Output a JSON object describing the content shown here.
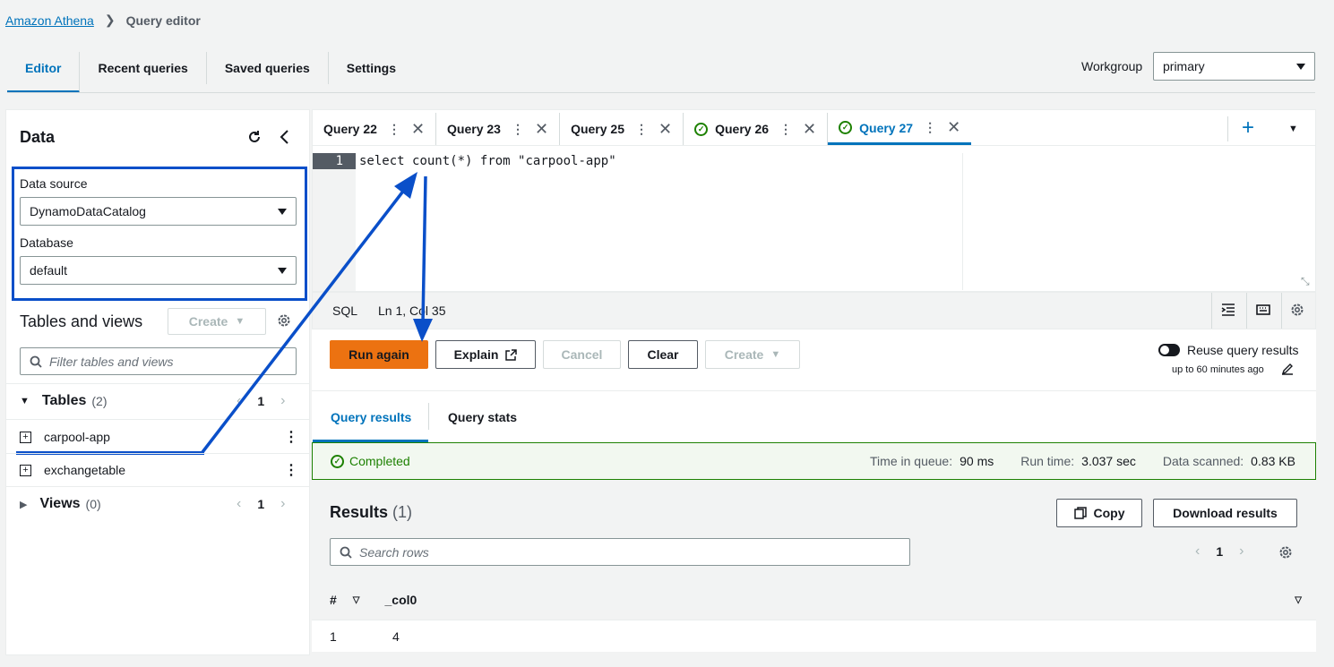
{
  "breadcrumb": {
    "root": "Amazon Athena",
    "current": "Query editor"
  },
  "top_tabs": [
    {
      "label": "Editor",
      "active": true
    },
    {
      "label": "Recent queries",
      "active": false
    },
    {
      "label": "Saved queries",
      "active": false
    },
    {
      "label": "Settings",
      "active": false
    }
  ],
  "workgroup": {
    "label": "Workgroup",
    "value": "primary"
  },
  "data_panel": {
    "title": "Data",
    "data_source_label": "Data source",
    "data_source_value": "DynamoDataCatalog",
    "database_label": "Database",
    "database_value": "default",
    "tables_and_views_title": "Tables and views",
    "create_label": "Create",
    "filter_placeholder": "Filter tables and views",
    "tables_label": "Tables",
    "tables_count": "(2)",
    "tables_page": "1",
    "tables": [
      {
        "name": "carpool-app"
      },
      {
        "name": "exchangetable"
      }
    ],
    "views_label": "Views",
    "views_count": "(0)",
    "views_page": "1"
  },
  "query_tabs": [
    {
      "label": "Query 22",
      "completed": false,
      "active": false
    },
    {
      "label": "Query 23",
      "completed": false,
      "active": false
    },
    {
      "label": "Query 25",
      "completed": false,
      "active": false
    },
    {
      "label": "Query 26",
      "completed": true,
      "active": false
    },
    {
      "label": "Query 27",
      "completed": true,
      "active": true
    }
  ],
  "editor": {
    "line_number": "1",
    "code_keyword": "select",
    "code_func": "count(*)",
    "code_from": "from",
    "code_string": "\"carpool-app\"",
    "language": "SQL",
    "cursor_pos": "Ln 1, Col 35"
  },
  "actions": {
    "run_again": "Run again",
    "explain": "Explain",
    "cancel": "Cancel",
    "clear": "Clear",
    "create": "Create",
    "reuse_label": "Reuse query results",
    "reuse_sub": "up to 60 minutes ago"
  },
  "results_tabs": {
    "results": "Query results",
    "stats": "Query stats"
  },
  "status": {
    "state": "Completed",
    "time_in_queue_label": "Time in queue:",
    "time_in_queue": "90 ms",
    "run_time_label": "Run time:",
    "run_time": "3.037 sec",
    "data_scanned_label": "Data scanned:",
    "data_scanned": "0.83 KB"
  },
  "results": {
    "title": "Results",
    "count": "(1)",
    "copy_label": "Copy",
    "download_label": "Download results",
    "search_placeholder": "Search rows",
    "page": "1",
    "columns": [
      "#",
      "_col0"
    ],
    "rows": [
      [
        "1",
        "4"
      ]
    ]
  },
  "colors": {
    "accent": "#0073bb",
    "primary_button": "#ec7211",
    "success": "#1d8102",
    "annotation": "#0a4fc9"
  }
}
